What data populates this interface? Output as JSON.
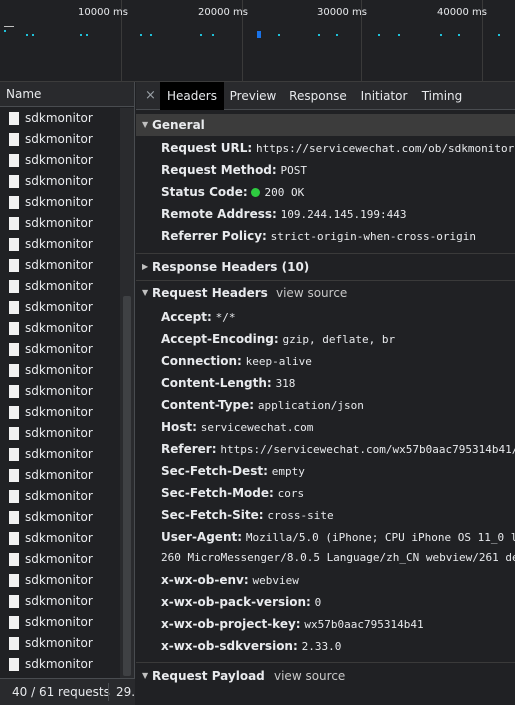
{
  "overview": {
    "ticks": [
      "10000 ms",
      "20000 ms",
      "30000 ms",
      "40000 ms"
    ]
  },
  "list": {
    "header": "Name",
    "rows": [
      "sdkmonitor",
      "sdkmonitor",
      "sdkmonitor",
      "sdkmonitor",
      "sdkmonitor",
      "sdkmonitor",
      "sdkmonitor",
      "sdkmonitor",
      "sdkmonitor",
      "sdkmonitor",
      "sdkmonitor",
      "sdkmonitor",
      "sdkmonitor",
      "sdkmonitor",
      "sdkmonitor",
      "sdkmonitor",
      "sdkmonitor",
      "sdkmonitor",
      "sdkmonitor",
      "sdkmonitor",
      "sdkmonitor",
      "sdkmonitor",
      "sdkmonitor",
      "sdkmonitor",
      "sdkmonitor",
      "sdkmonitor",
      "sdkmonitor"
    ],
    "status_count": "40 / 61 requests",
    "status_extra": "29."
  },
  "tabs": {
    "close": "×",
    "items": [
      "Headers",
      "Preview",
      "Response",
      "Initiator",
      "Timing"
    ],
    "active": "Headers"
  },
  "general": {
    "title": "General",
    "request_url_key": "Request URL:",
    "request_url": "https://servicewechat.com/ob/sdkmonitor",
    "request_method_key": "Request Method:",
    "request_method": "POST",
    "status_code_key": "Status Code:",
    "status_code": "200 OK",
    "remote_address_key": "Remote Address:",
    "remote_address": "109.244.145.199:443",
    "referrer_policy_key": "Referrer Policy:",
    "referrer_policy": "strict-origin-when-cross-origin"
  },
  "response_headers": {
    "title": "Response Headers (10)"
  },
  "request_headers": {
    "title": "Request Headers",
    "view_source": "view source",
    "accept_key": "Accept:",
    "accept": "*/*",
    "accept_encoding_key": "Accept-Encoding:",
    "accept_encoding": "gzip, deflate, br",
    "connection_key": "Connection:",
    "connection": "keep-alive",
    "content_length_key": "Content-Length:",
    "content_length": "318",
    "content_type_key": "Content-Type:",
    "content_type": "application/json",
    "host_key": "Host:",
    "host": "servicewechat.com",
    "referer_key": "Referer:",
    "referer": "https://servicewechat.com/wx57b0aac795314b41/d",
    "sec_fetch_dest_key": "Sec-Fetch-Dest:",
    "sec_fetch_dest": "empty",
    "sec_fetch_mode_key": "Sec-Fetch-Mode:",
    "sec_fetch_mode": "cors",
    "sec_fetch_site_key": "Sec-Fetch-Site:",
    "sec_fetch_site": "cross-site",
    "user_agent_key": "User-Agent:",
    "user_agent": "Mozilla/5.0 (iPhone; CPU iPhone OS 11_0 lik",
    "user_agent_cont": "260 MicroMessenger/8.0.5 Language/zh_CN webview/261 de",
    "x_wx_ob_env_key": "x-wx-ob-env:",
    "x_wx_ob_env": "webview",
    "x_wx_ob_pack_version_key": "x-wx-ob-pack-version:",
    "x_wx_ob_pack_version": "0",
    "x_wx_ob_project_key_key": "x-wx-ob-project-key:",
    "x_wx_ob_project_key": "wx57b0aac795314b41",
    "x_wx_ob_sdkversion_key": "x-wx-ob-sdkversion:",
    "x_wx_ob_sdkversion": "2.33.0"
  },
  "request_payload": {
    "title": "Request Payload",
    "view_source": "view source"
  },
  "colors": {
    "background": "#202124",
    "status_ok": "#2ecc40",
    "timeline_dot": "#20c0d8"
  }
}
